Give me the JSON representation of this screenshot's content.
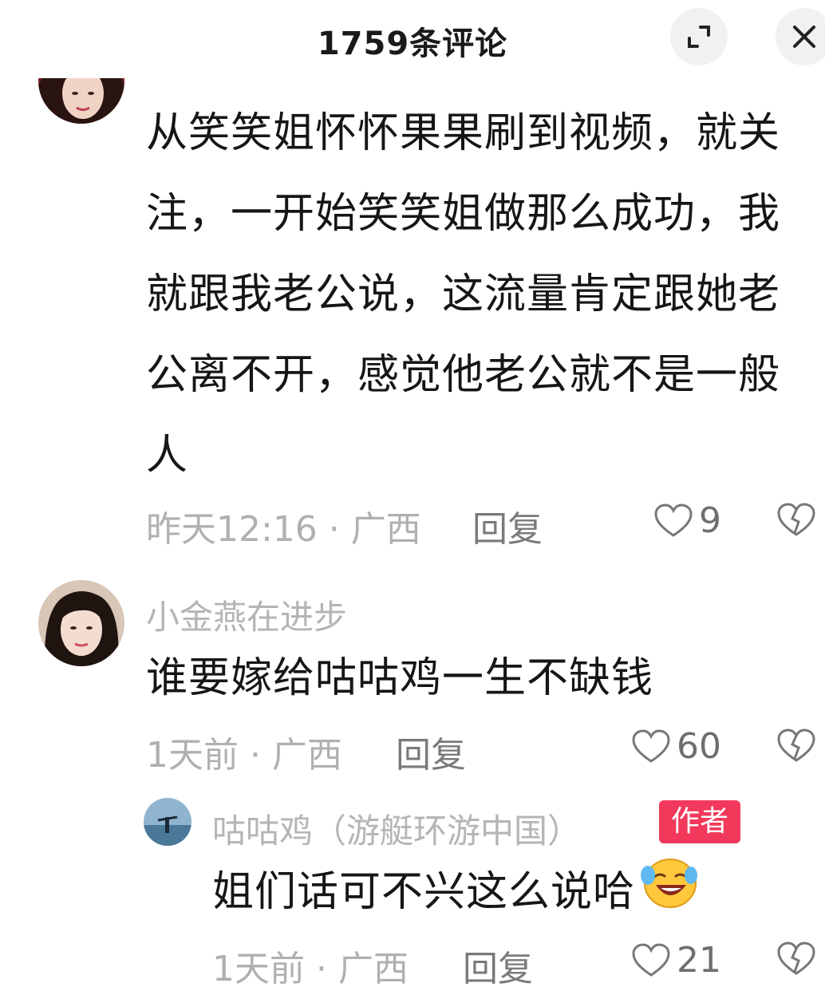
{
  "header": {
    "title": "1759条评论",
    "expand_icon": "expand-icon",
    "close_icon": "close-icon"
  },
  "comments": [
    {
      "username": "",
      "text": "从笑笑姐怀怀果果刷到视频，就关注，一开始笑笑姐做那么成功，我就跟我老公说，这流量肯定跟她老公离不开，感觉他老公就不是一般人",
      "meta": "昨天12:16 · 广西",
      "reply_label": "回复",
      "likes": "9"
    },
    {
      "username": "小金燕在进步",
      "text": "谁要嫁给咕咕鸡一生不缺钱",
      "meta": "1天前 · 广西",
      "reply_label": "回复",
      "likes": "60"
    }
  ],
  "reply": {
    "username": "咕咕鸡（游艇环游中国）",
    "badge": "作者",
    "text": "姐们话可不兴这么说哈",
    "emoji": "laughing-face-emoji",
    "meta": "1天前 · 广西",
    "reply_label": "回复",
    "likes": "21"
  },
  "colors": {
    "badge": "#f2395b",
    "meta_text": "#b0b0b0",
    "body_text": "#161616"
  }
}
